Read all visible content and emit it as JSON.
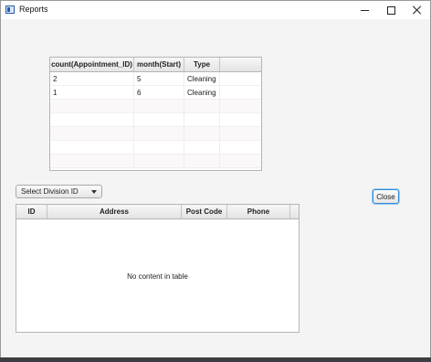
{
  "window": {
    "title": "Reports",
    "controls": [
      "minimize",
      "maximize",
      "close"
    ]
  },
  "appointments_table": {
    "columns": [
      "count(Appointment_ID)",
      "month(Start)",
      "Type",
      ""
    ],
    "rows": [
      [
        "2",
        "5",
        "Cleaning",
        ""
      ],
      [
        "1",
        "6",
        "Cleaning",
        ""
      ]
    ]
  },
  "division_select": {
    "placeholder": "Select Division ID"
  },
  "close_button": {
    "label": "Close"
  },
  "customer_table": {
    "columns": [
      "ID",
      "Address",
      "Post Code",
      "Phone",
      ""
    ],
    "empty_message": "No content in table"
  }
}
